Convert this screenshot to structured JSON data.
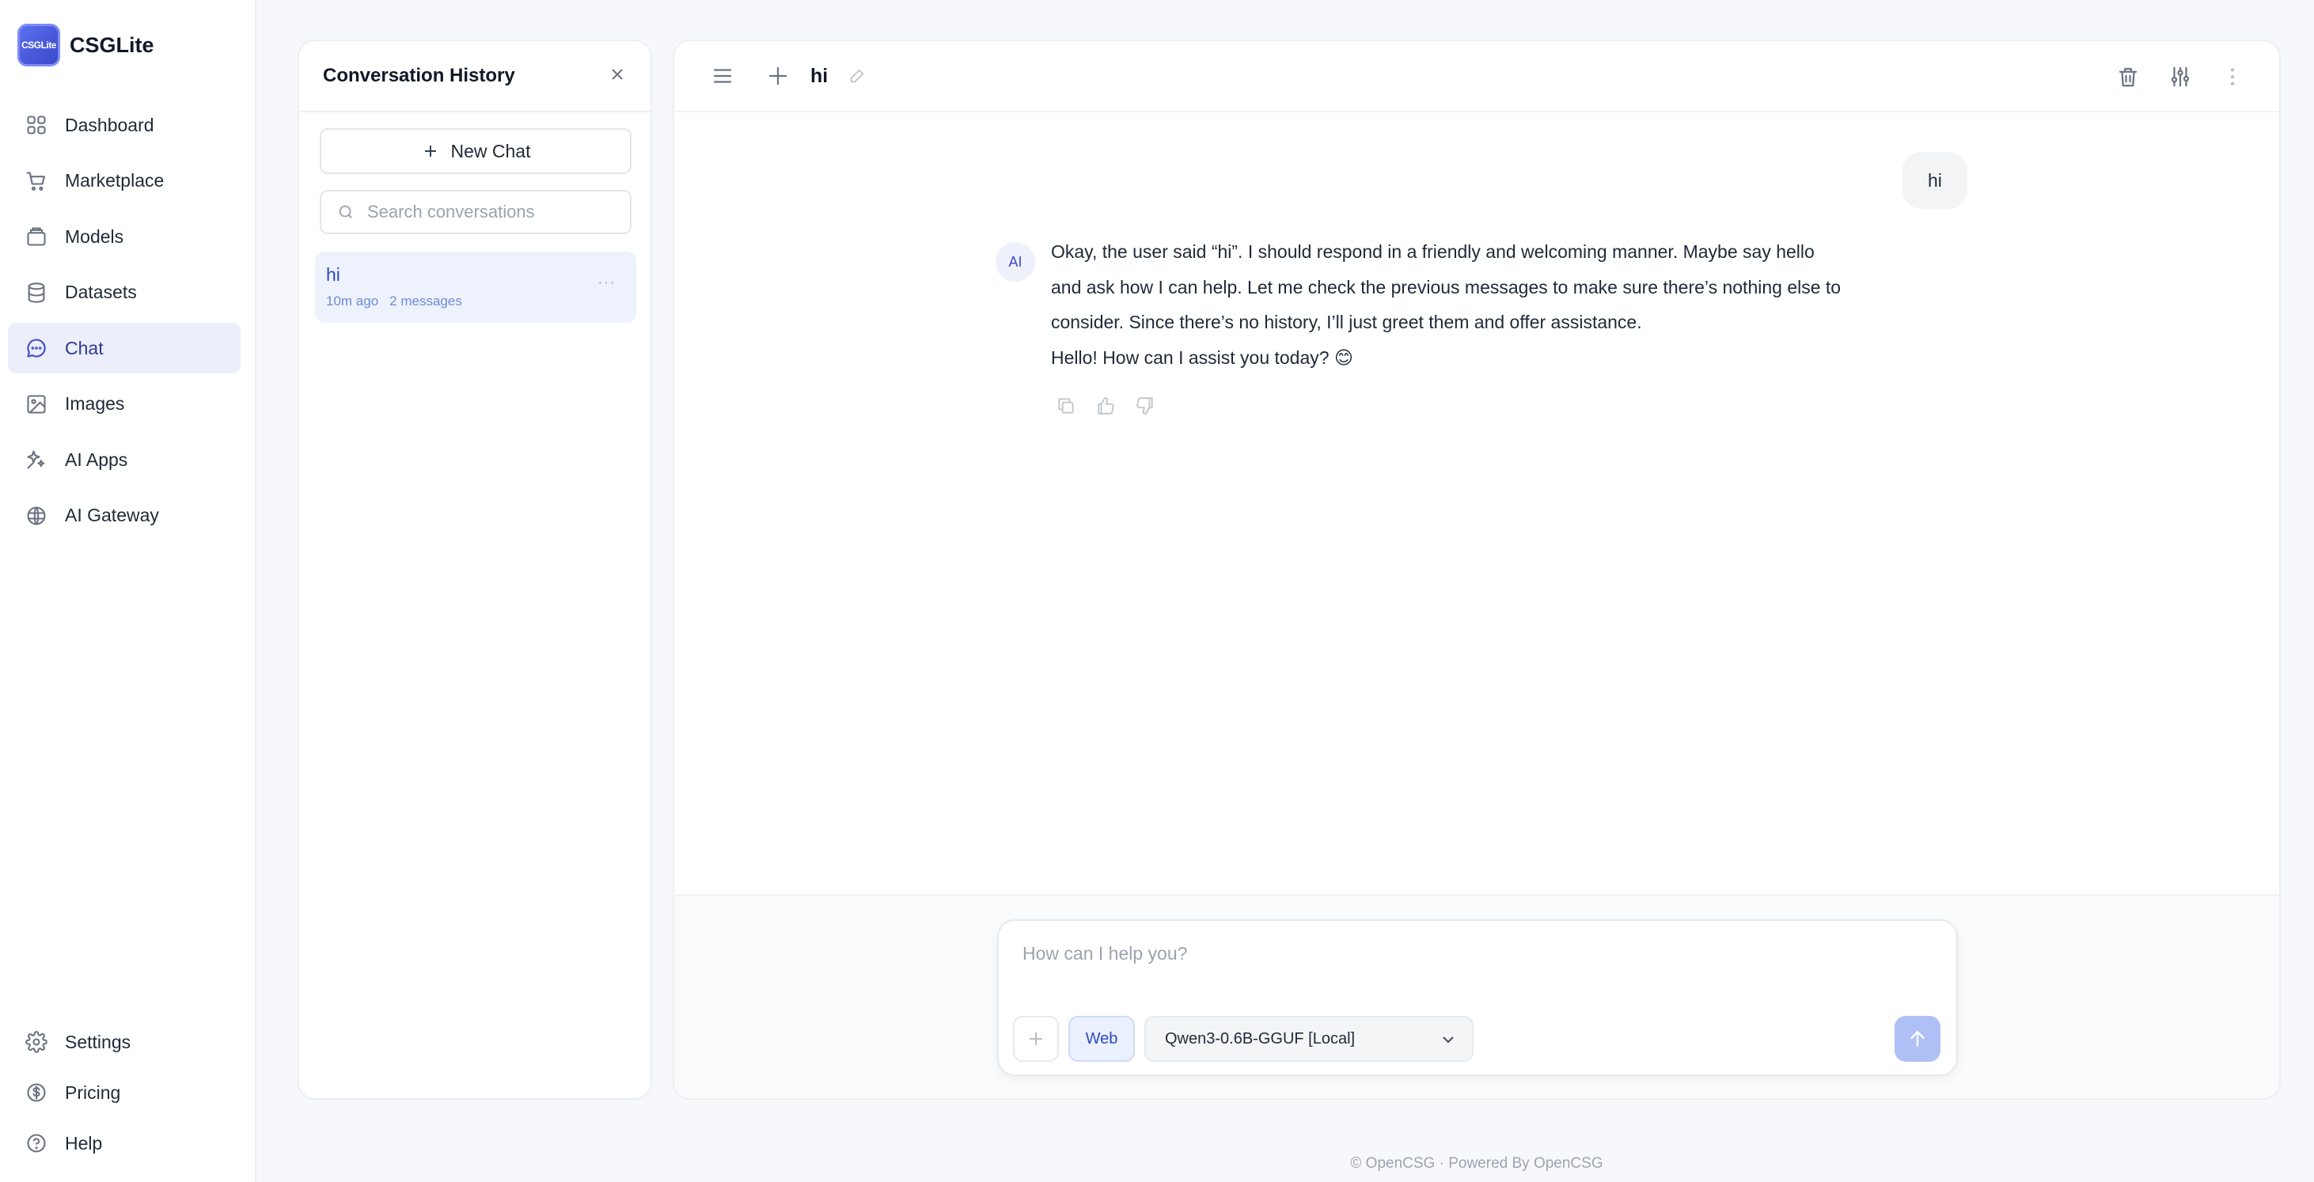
{
  "app": {
    "name": "CSGLite",
    "logo_text": "CSGLite"
  },
  "nav": {
    "items": [
      {
        "label": "Dashboard",
        "icon": "dashboard-icon"
      },
      {
        "label": "Marketplace",
        "icon": "cart-icon"
      },
      {
        "label": "Models",
        "icon": "models-icon"
      },
      {
        "label": "Datasets",
        "icon": "database-icon"
      },
      {
        "label": "Chat",
        "icon": "chat-icon",
        "active": true
      },
      {
        "label": "Images",
        "icon": "image-icon"
      },
      {
        "label": "AI Apps",
        "icon": "sparkles-icon"
      },
      {
        "label": "AI Gateway",
        "icon": "gateway-icon"
      }
    ],
    "bottom": [
      {
        "label": "Settings",
        "icon": "gear-icon"
      },
      {
        "label": "Pricing",
        "icon": "dollar-icon"
      },
      {
        "label": "Help",
        "icon": "help-icon"
      }
    ]
  },
  "history": {
    "title": "Conversation History",
    "new_chat": "New Chat",
    "search_placeholder": "Search conversations",
    "conversations": [
      {
        "title": "hi",
        "time": "10m ago",
        "count": "2 messages"
      }
    ]
  },
  "chat": {
    "title": "hi",
    "user_message": "hi",
    "ai_avatar": "AI",
    "ai_thinking": "Okay, the user said “hi”. I should respond in a friendly and welcoming manner. Maybe say hello and ask how I can help. Let me check the previous messages to make sure there’s nothing else to consider. Since there’s no history, I’ll just greet them and offer assistance.",
    "ai_reply": "Hello! How can I assist you today? 😊"
  },
  "composer": {
    "placeholder": "How can I help you?",
    "web_label": "Web",
    "model": "Qwen3-0.6B-GGUF [Local]"
  },
  "footer": "© OpenCSG · Powered By OpenCSG"
}
